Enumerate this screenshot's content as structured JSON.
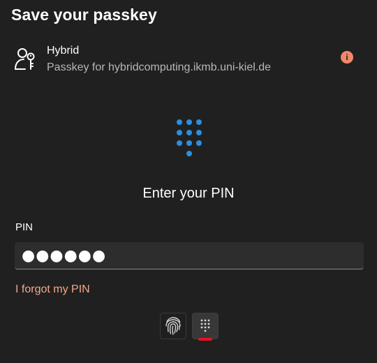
{
  "dialog": {
    "title": "Save your passkey"
  },
  "account": {
    "icon": "passkey-icon",
    "name": "Hybrid",
    "description": "Passkey for hybridcomputing.ikmb.uni-kiel.de",
    "info_icon": "info-icon",
    "info_glyph": "i"
  },
  "pin_prompt": {
    "icon": "keypad-icon",
    "heading": "Enter your PIN",
    "field_label": "PIN",
    "field_value": "●●●●●●",
    "forgot_link": "I forgot my PIN"
  },
  "sign_in_options": {
    "items": [
      {
        "icon": "fingerprint-icon",
        "selected": false
      },
      {
        "icon": "pin-keypad-icon",
        "selected": true
      }
    ]
  },
  "colors": {
    "background": "#202020",
    "accent_blue": "#2b8fe0",
    "link": "#f2a88a",
    "info": "#f2876a",
    "selected_indicator": "#e81123"
  }
}
